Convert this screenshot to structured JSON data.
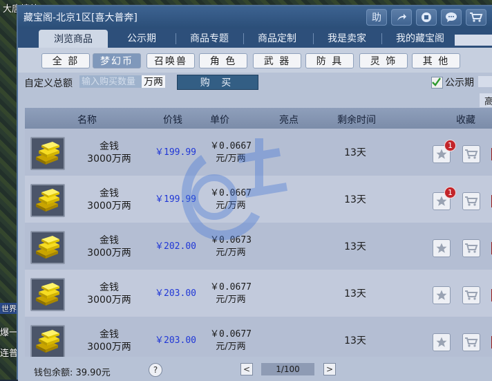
{
  "window": {
    "title": "藏宝阁-北京1区[喜大普奔]"
  },
  "title_icons": [
    {
      "icon": "help-icon",
      "label": "助"
    },
    {
      "icon": "share-icon",
      "label": "↗"
    },
    {
      "icon": "record-icon",
      "label": "●"
    },
    {
      "icon": "chat-icon",
      "label": "●"
    },
    {
      "icon": "cart-icon",
      "label": ""
    }
  ],
  "tabs": [
    {
      "label": "浏览商品",
      "active": true
    },
    {
      "label": "公示期"
    },
    {
      "label": "商品专题"
    },
    {
      "label": "商品定制"
    },
    {
      "label": "我是卖家"
    },
    {
      "label": "我的藏宝阁"
    }
  ],
  "categories": [
    {
      "label": "全 部"
    },
    {
      "label": "梦幻币",
      "active": true
    },
    {
      "label": "召唤兽"
    },
    {
      "label": "角 色"
    },
    {
      "label": "武 器"
    },
    {
      "label": "防 具"
    },
    {
      "label": "灵 饰"
    },
    {
      "label": "其 他"
    }
  ],
  "filter": {
    "label": "自定义总额",
    "placeholder": "输入购买数量",
    "unit": "万两",
    "buy_label": "购 买",
    "gongshi_label": "公示期",
    "gongshi_checked": true,
    "gao_label": "高"
  },
  "table": {
    "headers": [
      "名称",
      "价钱",
      "单价",
      "亮点",
      "剩余时间",
      "收藏"
    ],
    "rows": [
      {
        "name": "金钱",
        "amount": "3000万两",
        "price": "￥199.99",
        "unit_price": "￥0.0667",
        "unit_label": "元/万两",
        "time": "13天",
        "badge": "1"
      },
      {
        "name": "金钱",
        "amount": "3000万两",
        "price": "￥199.99",
        "unit_price": "￥0.0667",
        "unit_label": "元/万两",
        "time": "13天",
        "badge": "1"
      },
      {
        "name": "金钱",
        "amount": "3000万两",
        "price": "￥202.00",
        "unit_price": "￥0.0673",
        "unit_label": "元/万两",
        "time": "13天",
        "badge": ""
      },
      {
        "name": "金钱",
        "amount": "3000万两",
        "price": "￥203.00",
        "unit_price": "￥0.0677",
        "unit_label": "元/万两",
        "time": "13天",
        "badge": ""
      },
      {
        "name": "金钱",
        "amount": "3000万两",
        "price": "￥203.00",
        "unit_price": "￥0.0677",
        "unit_label": "元/万两",
        "time": "13天",
        "badge": ""
      }
    ]
  },
  "footer": {
    "wallet": "钱包余额: 39.90元",
    "help": "?",
    "prev": "<",
    "page": "1/100",
    "next": ">"
  },
  "background_text": [
    "大唐境外",
    "世界",
    "爆一",
    "连普"
  ],
  "colors": {
    "titlebar": "#2b4e78",
    "price": "#2037d6",
    "badge": "#c2242a"
  }
}
